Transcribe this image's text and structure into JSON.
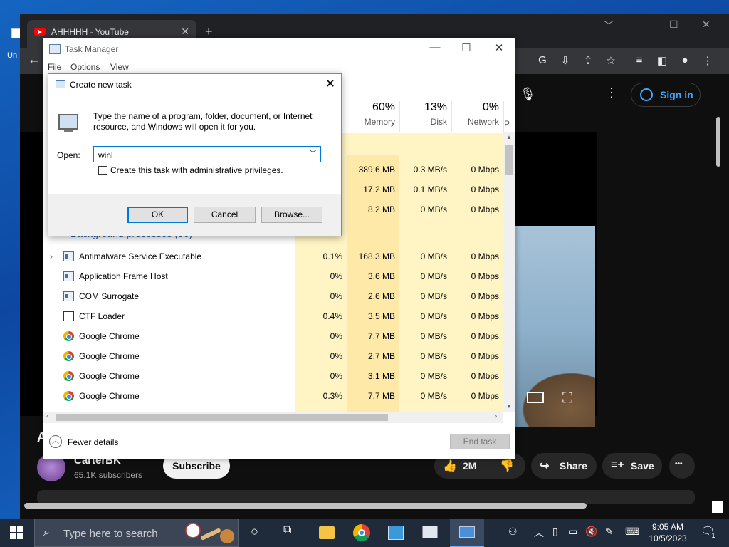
{
  "desktop": {
    "icon_label": "Un"
  },
  "chrome": {
    "tab_title": "AHHHHH - YouTube",
    "new_tab": "+",
    "controls": {
      "minimize": "﹀",
      "restore": "☐",
      "close": "✕"
    }
  },
  "youtube": {
    "sign_in": "Sign in",
    "channel_name": "CarterBK",
    "subscribers": "65.1K subscribers",
    "subscribe": "Subscribe",
    "likes": "2M",
    "share": "Share",
    "save": "Save",
    "more": "•••",
    "title_partial": "A"
  },
  "task_manager": {
    "title": "Task Manager",
    "menu": [
      "File",
      "Options",
      "View"
    ],
    "columns": {
      "memory": {
        "pct": "60%",
        "name": "Memory"
      },
      "disk": {
        "pct": "13%",
        "name": "Disk"
      },
      "network": {
        "pct": "0%",
        "name": "Network"
      },
      "extra": "P"
    },
    "section_label": "Background processes (96)",
    "top_rows": [
      {
        "memory": "389.6 MB",
        "disk": "0.3 MB/s",
        "network": "0 Mbps"
      },
      {
        "memory": "17.2 MB",
        "disk": "0.1 MB/s",
        "network": "0 Mbps"
      },
      {
        "memory": "8.2 MB",
        "disk": "0 MB/s",
        "network": "0 Mbps"
      }
    ],
    "rows": [
      {
        "name": "Antimalware Service Executable",
        "cpu": "0.1%",
        "memory": "168.3 MB",
        "disk": "0 MB/s",
        "network": "0 Mbps",
        "expand": "›"
      },
      {
        "name": "Application Frame Host",
        "cpu": "0%",
        "memory": "3.6 MB",
        "disk": "0 MB/s",
        "network": "0 Mbps"
      },
      {
        "name": "COM Surrogate",
        "cpu": "0%",
        "memory": "2.6 MB",
        "disk": "0 MB/s",
        "network": "0 Mbps"
      },
      {
        "name": "CTF Loader",
        "cpu": "0.4%",
        "memory": "3.5 MB",
        "disk": "0 MB/s",
        "network": "0 Mbps"
      },
      {
        "name": "Google Chrome",
        "cpu": "0%",
        "memory": "7.7 MB",
        "disk": "0 MB/s",
        "network": "0 Mbps"
      },
      {
        "name": "Google Chrome",
        "cpu": "0%",
        "memory": "2.7 MB",
        "disk": "0 MB/s",
        "network": "0 Mbps"
      },
      {
        "name": "Google Chrome",
        "cpu": "0%",
        "memory": "3.1 MB",
        "disk": "0 MB/s",
        "network": "0 Mbps"
      },
      {
        "name": "Google Chrome",
        "cpu": "0.3%",
        "memory": "7.7 MB",
        "disk": "0 MB/s",
        "network": "0 Mbps"
      }
    ],
    "fewer_details": "Fewer details",
    "end_task": "End task"
  },
  "dialog": {
    "title": "Create new task",
    "description": "Type the name of a program, folder, document, or Internet resource, and Windows will open it for you.",
    "open_label": "Open:",
    "open_value": "winl",
    "admin_label": "Create this task with administrative privileges.",
    "ok": "OK",
    "cancel": "Cancel",
    "browse": "Browse..."
  },
  "taskbar": {
    "search_placeholder": "Type here to search",
    "time": "9:05 AM",
    "date": "10/5/2023",
    "notification_count": "1"
  },
  "colors": {
    "accent": "#0078d7",
    "cpu_cell": "#fff4c4",
    "mem_cell": "#ffe9a8",
    "youtube_red": "#ff0000",
    "link_blue": "#3ea6ff"
  }
}
